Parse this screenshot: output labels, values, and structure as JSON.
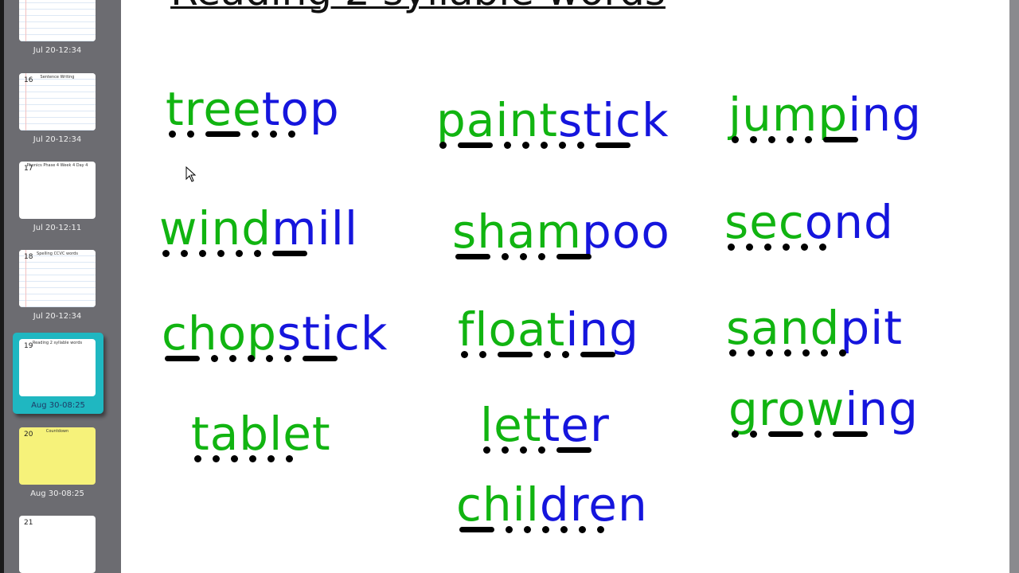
{
  "sidebar": {
    "slides": [
      {
        "number": "",
        "title": "",
        "timestamp": "Jul 20-12:34"
      },
      {
        "number": "16",
        "title": "Sentence Writing",
        "timestamp": "Jul 20-12:34"
      },
      {
        "number": "17",
        "title": "Phonics Phase 4 Week 4 Day 4",
        "timestamp": "Jul 20-12:11"
      },
      {
        "number": "18",
        "title": "Spelling CCVC words",
        "timestamp": "Jul 20-12:34"
      },
      {
        "number": "19",
        "title": "Reading 2 syllable words",
        "timestamp": "Aug 30-08:25",
        "selected": true
      },
      {
        "number": "20",
        "title": "Countdown",
        "timestamp": "Aug 30-08:25"
      },
      {
        "number": "21",
        "title": "",
        "timestamp": ""
      }
    ],
    "selected_color": "#1fb7c1"
  },
  "slide": {
    "title": "Reading 2 syllable words",
    "colors": {
      "first_syllable": "#11b411",
      "second_syllable": "#1515dd"
    },
    "words": [
      {
        "parts": [
          "tree",
          "top"
        ],
        "marks": [
          "dot",
          "dot",
          "dash",
          "dot",
          "dot",
          "dot"
        ]
      },
      {
        "parts": [
          "paint",
          "stick"
        ],
        "marks": [
          "dot",
          "dash",
          "dot",
          "dot",
          "dot",
          "dot",
          "dot",
          "dash"
        ]
      },
      {
        "parts": [
          "jump",
          "ing"
        ],
        "marks": [
          "dot",
          "dot",
          "dot",
          "dot",
          "dot",
          "dash"
        ]
      },
      {
        "parts": [
          "wind",
          "mill"
        ],
        "marks": [
          "dot",
          "dot",
          "dot",
          "dot",
          "dot",
          "dot",
          "dash"
        ]
      },
      {
        "parts": [
          "sham",
          "poo"
        ],
        "marks": [
          "dash",
          "dot",
          "dot",
          "dot",
          "dash"
        ]
      },
      {
        "parts": [
          "sec",
          "ond"
        ],
        "marks": [
          "dot",
          "dot",
          "dot",
          "dot",
          "dot",
          "dot"
        ]
      },
      {
        "parts": [
          "chop",
          "stick"
        ],
        "marks": [
          "dash",
          "dot",
          "dot",
          "dot",
          "dot",
          "dot",
          "dash"
        ]
      },
      {
        "parts": [
          "float",
          "ing"
        ],
        "marks": [
          "dot",
          "dot",
          "dash",
          "dot",
          "dot",
          "dash"
        ]
      },
      {
        "parts": [
          "sand",
          "pit"
        ],
        "marks": [
          "dot",
          "dot",
          "dot",
          "dot",
          "dot",
          "dot",
          "dot"
        ]
      },
      {
        "parts": [
          "tablet",
          ""
        ],
        "marks": [
          "dot",
          "dot",
          "dot",
          "dot",
          "dot",
          "dot"
        ]
      },
      {
        "parts": [
          "let",
          "ter"
        ],
        "marks": [
          "dot",
          "dot",
          "dot",
          "dot",
          "dash"
        ]
      },
      {
        "parts": [
          "grow",
          "ing"
        ],
        "marks": [
          "dot",
          "dot",
          "dash",
          "dot",
          "dash"
        ]
      },
      {
        "parts": [
          "chil",
          "dren"
        ],
        "marks": [
          "dash",
          "dot",
          "dot",
          "dot",
          "dot",
          "dot",
          "dot"
        ]
      }
    ]
  }
}
